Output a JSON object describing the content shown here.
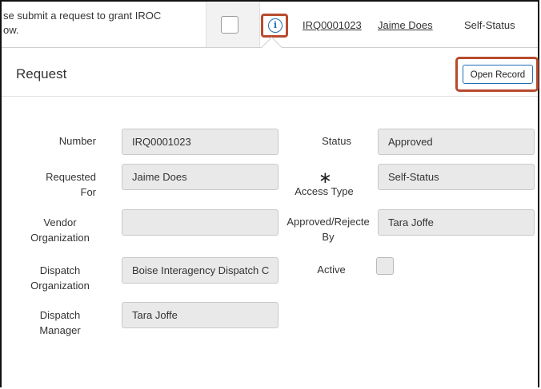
{
  "list_row": {
    "description": "se submit a request to grant IROC\now.",
    "number": "IRQ0001023",
    "requested_for": "Jaime Does",
    "access_type": "Self-Status"
  },
  "popover": {
    "title": "Request",
    "open_record_label": "Open Record",
    "fields": {
      "number_label": "Number",
      "number_value": "IRQ0001023",
      "requested_for_label": "Requested\nFor",
      "requested_for_value": "Jaime Does",
      "vendor_org_label": "Vendor\nOrganization",
      "vendor_org_value": "",
      "dispatch_org_label": "Dispatch\nOrganization",
      "dispatch_org_value": "Boise Interagency Dispatch C",
      "dispatch_manager_label": "Dispatch\nManager",
      "dispatch_manager_value": "Tara Joffe",
      "status_label": "Status",
      "status_value": "Approved",
      "access_type_label": "Access Type",
      "access_type_required": "∗",
      "access_type_value": "Self-Status",
      "approved_by_label": "Approved/Rejecte\nBy",
      "approved_by_value": "Tara Joffe",
      "active_label": "Active",
      "active_checked": false
    }
  },
  "colors": {
    "highlight": "#b84a2e",
    "accent": "#1f6fb5",
    "field_bg": "#e9e9e9"
  },
  "icons": {
    "info": "info-icon"
  }
}
